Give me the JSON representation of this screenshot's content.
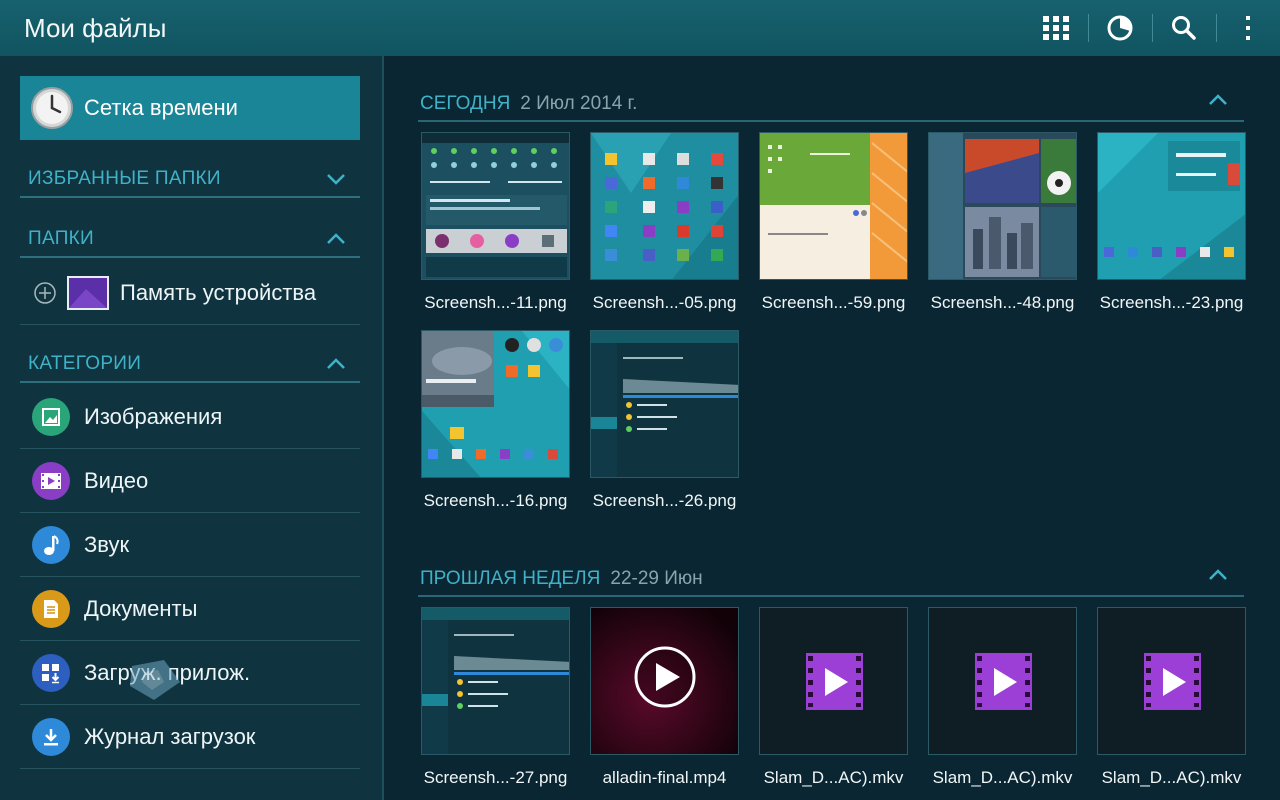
{
  "header": {
    "title": "Мои файлы",
    "icons": [
      "grid-icon",
      "storage-pie-icon",
      "search-icon",
      "more-icon"
    ]
  },
  "sidebar": {
    "timeline_label": "Сетка времени",
    "favorites_header": "ИЗБРАННЫЕ ПАПКИ",
    "folders_header": "ПАПКИ",
    "device_memory_label": "Память устройства",
    "categories_header": "КАТЕГОРИИ",
    "categories": [
      {
        "label": "Изображения",
        "icon": "images-icon",
        "color": "#2aa57a"
      },
      {
        "label": "Видео",
        "icon": "video-icon",
        "color": "#8a3ec6"
      },
      {
        "label": "Звук",
        "icon": "music-icon",
        "color": "#2e8ad8"
      },
      {
        "label": "Документы",
        "icon": "documents-icon",
        "color": "#d99a1a"
      },
      {
        "label": "Загруж. прилож.",
        "icon": "downloaded-apps-icon",
        "color": "#2c5fbf"
      },
      {
        "label": "Журнал загрузок",
        "icon": "download-history-icon",
        "color": "#2e8ad8"
      }
    ]
  },
  "groups": [
    {
      "title": "СЕГОДНЯ",
      "date": "2 Июл 2014 г.",
      "items": [
        {
          "name": "Screensh...-11.png",
          "kind": "image"
        },
        {
          "name": "Screensh...-05.png",
          "kind": "image"
        },
        {
          "name": "Screensh...-59.png",
          "kind": "image"
        },
        {
          "name": "Screensh...-48.png",
          "kind": "image"
        },
        {
          "name": "Screensh...-23.png",
          "kind": "image"
        },
        {
          "name": "Screensh...-16.png",
          "kind": "image"
        },
        {
          "name": "Screensh...-26.png",
          "kind": "image"
        }
      ]
    },
    {
      "title": "ПРОШЛАЯ НЕДЕЛЯ",
      "date": "22-29 Июн",
      "items": [
        {
          "name": "Screensh...-27.png",
          "kind": "image"
        },
        {
          "name": "alladin-final.mp4",
          "kind": "video"
        },
        {
          "name": "Slam_D...AC).mkv",
          "kind": "video-file"
        },
        {
          "name": "Slam_D...AC).mkv",
          "kind": "video-file"
        },
        {
          "name": "Slam_D...AC).mkv",
          "kind": "video-file"
        }
      ]
    }
  ],
  "colors": {
    "accent": "#3fb2c8",
    "action_bar": "#145a67",
    "selected": "#1a8596",
    "video_purple": "#9b3fd6"
  }
}
